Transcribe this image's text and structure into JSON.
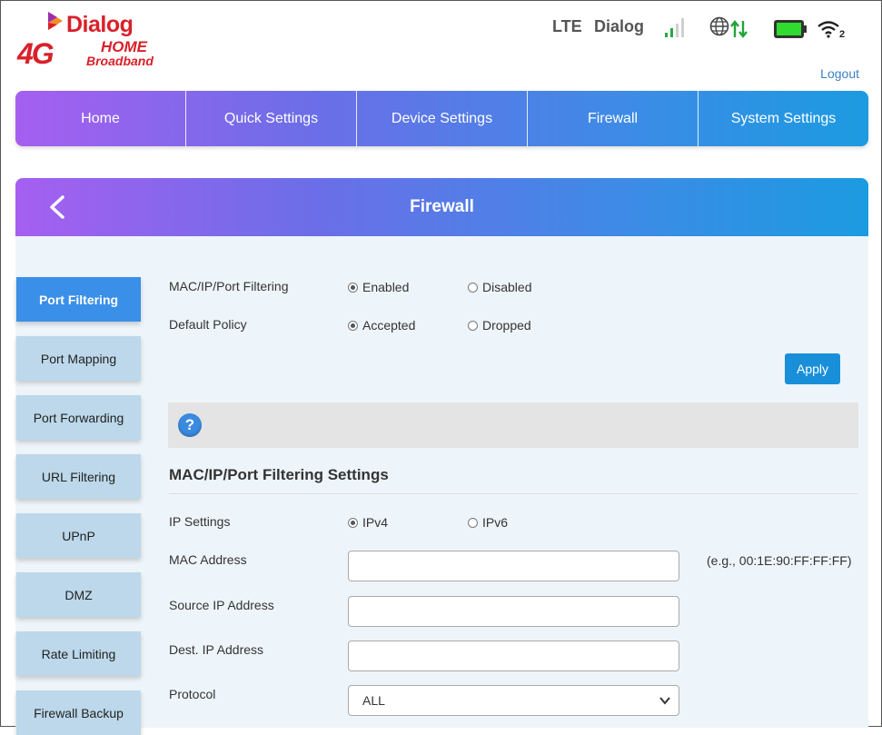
{
  "brand": {
    "name": "Dialog",
    "tagline_4g": "4G",
    "tagline_home": "HOME",
    "tagline_broadband": "Broadband",
    "colors": {
      "brand_red": "#d9202a",
      "accent_blue": "#1a8fd9"
    }
  },
  "status": {
    "network_type": "LTE",
    "carrier": "Dialog",
    "wifi_clients": "2",
    "icons": [
      "signal-strength-icon",
      "globe-icon",
      "data-transfer-icon",
      "battery-icon",
      "wifi-icon"
    ]
  },
  "header": {
    "logout_label": "Logout"
  },
  "nav": {
    "items": [
      {
        "label": "Home"
      },
      {
        "label": "Quick Settings"
      },
      {
        "label": "Device Settings"
      },
      {
        "label": "Firewall"
      },
      {
        "label": "System Settings"
      }
    ]
  },
  "panel": {
    "title": "Firewall"
  },
  "sidebar": {
    "active": "Port Filtering",
    "items": [
      {
        "label": "Port Filtering"
      },
      {
        "label": "Port Mapping"
      },
      {
        "label": "Port Forwarding"
      },
      {
        "label": "URL Filtering"
      },
      {
        "label": "UPnP"
      },
      {
        "label": "DMZ"
      },
      {
        "label": "Rate Limiting"
      },
      {
        "label": "Firewall Backup"
      }
    ]
  },
  "form": {
    "filtering": {
      "label": "MAC/IP/Port Filtering",
      "options": [
        "Enabled",
        "Disabled"
      ],
      "selected": "Enabled"
    },
    "default_policy": {
      "label": "Default Policy",
      "options": [
        "Accepted",
        "Dropped"
      ],
      "selected": "Accepted"
    },
    "apply_label": "Apply",
    "section_title": "MAC/IP/Port Filtering Settings",
    "ip_settings": {
      "label": "IP Settings",
      "options": [
        "IPv4",
        "IPv6"
      ],
      "selected": "IPv4"
    },
    "mac_address": {
      "label": "MAC Address",
      "value": "",
      "hint": "(e.g., 00:1E:90:FF:FF:FF)"
    },
    "source_ip": {
      "label": "Source IP Address",
      "value": ""
    },
    "dest_ip": {
      "label": "Dest. IP Address",
      "value": ""
    },
    "protocol": {
      "label": "Protocol",
      "selected": "ALL"
    }
  }
}
